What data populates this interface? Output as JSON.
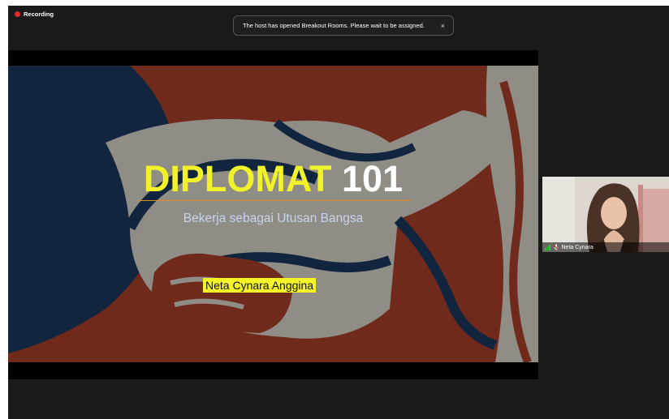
{
  "recording": {
    "label": "Recording"
  },
  "notification": {
    "message": "The host has opened Breakout Rooms. Please wait to be assigned.",
    "close_glyph": "×"
  },
  "slide": {
    "title_main": "DIPLOMAT",
    "title_number": "101",
    "subtitle": "Bekerja sebagai Utusan Bangsa",
    "presenter": "Neta Cynara Anggina"
  },
  "participant": {
    "name": "Neta Cynara",
    "mic_icon": "mic-muted-icon",
    "signal_icon": "signal-strength-icon"
  },
  "colors": {
    "window_bg": "#1a1a1a",
    "recording_dot": "#e02b2b",
    "title_yellow": "#f2f22a",
    "presenter_highlight": "#f4f428",
    "slide_red": "#b4442c",
    "slide_blue": "#1c3c66"
  }
}
